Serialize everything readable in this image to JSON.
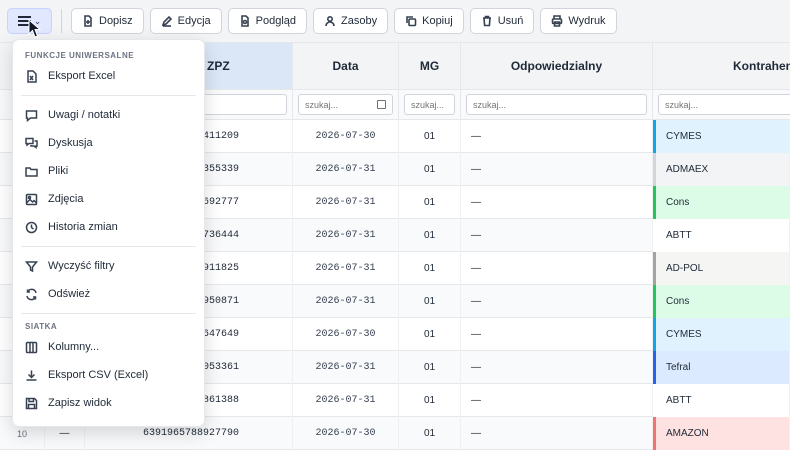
{
  "toolbar": {
    "buttons": [
      {
        "label": "Dopisz",
        "icon": "add-doc-icon"
      },
      {
        "label": "Edycja",
        "icon": "pencil-icon"
      },
      {
        "label": "Podgląd",
        "icon": "preview-icon"
      },
      {
        "label": "Zasoby",
        "icon": "user-icon"
      },
      {
        "label": "Kopiuj",
        "icon": "copy-icon"
      },
      {
        "label": "Usuń",
        "icon": "trash-icon"
      },
      {
        "label": "Wydruk",
        "icon": "printer-icon"
      }
    ]
  },
  "grid": {
    "headers": {
      "zpz": "ZPZ",
      "date": "Data",
      "mg": "MG",
      "odp": "Odpowiedzialny",
      "kon": "Kontrahent"
    },
    "filter_placeholder": "szukaj...",
    "rows": [
      {
        "num": "",
        "dash": "",
        "zpz": "411209",
        "date": "2026-07-30",
        "mg": "01",
        "odp": "—",
        "kon": "CYMES",
        "kon_color": "#e0f2fe",
        "kon_border": "#0ea5e9"
      },
      {
        "num": "",
        "dash": "",
        "zpz": "355339",
        "date": "2026-07-31",
        "mg": "01",
        "odp": "—",
        "kon": "ADMAEX",
        "kon_color": "#f3f4f6",
        "kon_border": "#d1d5db"
      },
      {
        "num": "",
        "dash": "",
        "zpz": "692777",
        "date": "2026-07-31",
        "mg": "01",
        "odp": "—",
        "kon": "Cons",
        "kon_color": "#dcfce7",
        "kon_border": "#22c55e"
      },
      {
        "num": "",
        "dash": "",
        "zpz": "736444",
        "date": "2026-07-31",
        "mg": "01",
        "odp": "—",
        "kon": "ABTT",
        "kon_color": "#ffffff",
        "kon_border": "#ffffff"
      },
      {
        "num": "",
        "dash": "",
        "zpz": "911825",
        "date": "2026-07-31",
        "mg": "01",
        "odp": "—",
        "kon": "AD-POL",
        "kon_color": "#f5f5f4",
        "kon_border": "#a8a29e"
      },
      {
        "num": "",
        "dash": "",
        "zpz": "950871",
        "date": "2026-07-31",
        "mg": "01",
        "odp": "—",
        "kon": "Cons",
        "kon_color": "#dcfce7",
        "kon_border": "#22c55e"
      },
      {
        "num": "",
        "dash": "",
        "zpz": "647649",
        "date": "2026-07-30",
        "mg": "01",
        "odp": "—",
        "kon": "CYMES",
        "kon_color": "#e0f2fe",
        "kon_border": "#0ea5e9"
      },
      {
        "num": "",
        "dash": "",
        "zpz": "053361",
        "date": "2026-07-31",
        "mg": "01",
        "odp": "—",
        "kon": "Tefral",
        "kon_color": "#dbeafe",
        "kon_border": "#2563eb"
      },
      {
        "num": "",
        "dash": "",
        "zpz": "861388",
        "date": "2026-07-31",
        "mg": "01",
        "odp": "—",
        "kon": "ABTT",
        "kon_color": "#ffffff",
        "kon_border": "#ffffff"
      },
      {
        "num": "10",
        "dash": "—",
        "zpz": "6391965788927790",
        "date": "2026-07-30",
        "mg": "01",
        "odp": "—",
        "kon": "AMAZON",
        "kon_color": "#fee2e2",
        "kon_border": "#f87171"
      }
    ]
  },
  "menu": {
    "section1": "FUNKCJE UNIWERSALNE",
    "export_excel": "Eksport Excel",
    "notes": "Uwagi / notatki",
    "discussion": "Dyskusja",
    "files": "Pliki",
    "photos": "Zdjęcia",
    "history": "Historia zmian",
    "clear_filters": "Wyczyść filtry",
    "refresh": "Odśwież",
    "section2": "SIATKA",
    "columns": "Kolumny...",
    "export_csv": "Eksport CSV (Excel)",
    "save_view": "Zapisz widok"
  }
}
